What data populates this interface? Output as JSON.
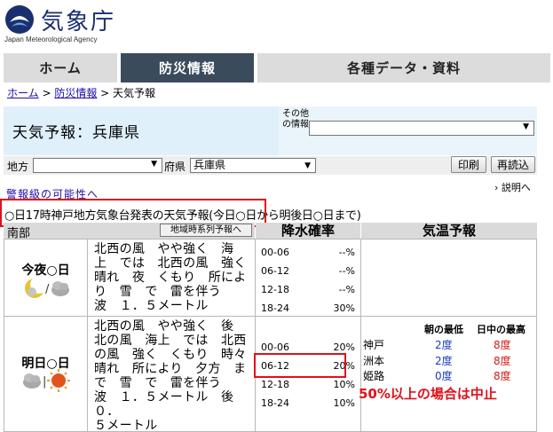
{
  "logo": {
    "text": "気象庁",
    "subtitle": "Japan Meteorological Agency",
    "icon": "jma-logo-icon"
  },
  "nav": {
    "home": "ホーム",
    "bosai": "防災情報",
    "data": "各種データ・資料"
  },
  "breadcrumb": {
    "home": "ホーム",
    "sep1": " > ",
    "bosai": "防災情報",
    "sep2": " > ",
    "current": "天気予報"
  },
  "title": "天気予報：兵庫県",
  "other_info": {
    "label": "その他の情報",
    "selected": ""
  },
  "region": {
    "label": "地方",
    "selected": "",
    "pref_label": "府県",
    "pref_selected": "兵庫県"
  },
  "buttons": {
    "print": "印刷",
    "reload": "再読込"
  },
  "warning_link": "警報級の可能性へ",
  "help_link": "説明へ",
  "announcement": "○日17時神戸地方気象台発表の天気予報(今日○日から明後日○日まで)",
  "table": {
    "col_area": "南部",
    "col_area_button": "地域時系列予報へ",
    "col_rain": "降水確率",
    "col_temp": "気温予報"
  },
  "days": [
    {
      "label": "今夜○日",
      "icons": [
        "moon-icon",
        "cloud-icon"
      ],
      "text": [
        "北西の風　やや強く　海",
        "上　では　北西の風　強く",
        "晴れ　夜　くもり　所によ",
        "り　雪　で　雷を伴う",
        "波　１．５メートル"
      ],
      "rain": [
        {
          "time": "00-06",
          "value": "--%"
        },
        {
          "time": "06-12",
          "value": "--%"
        },
        {
          "time": "12-18",
          "value": "--%"
        },
        {
          "time": "18-24",
          "value": "30%"
        }
      ]
    },
    {
      "label": "明日○日",
      "icons": [
        "cloud-icon",
        "sun-icon"
      ],
      "text": [
        "北西の風　やや強く　後",
        "北の風　海上　では　北西",
        "の風　強く　くもり　時々",
        "晴れ　所により　夕方　ま",
        "で　雪　で　雷を伴う",
        "波　１．５メートル　後　０．",
        "５メートル"
      ],
      "rain": [
        {
          "time": "00-06",
          "value": "20%"
        },
        {
          "time": "06-12",
          "value": "20%"
        },
        {
          "time": "12-18",
          "value": "10%"
        },
        {
          "time": "18-24",
          "value": "10%"
        }
      ],
      "temp": {
        "header_min": "朝の最低",
        "header_max": "日中の最高",
        "rows": [
          {
            "city": "神戸",
            "min": "2度",
            "max": "8度"
          },
          {
            "city": "洲本",
            "min": "2度",
            "max": "8度"
          },
          {
            "city": "姫路",
            "min": "0度",
            "max": "8度"
          }
        ]
      }
    }
  ],
  "note": "50%以上の場合は中止",
  "colors": {
    "accent_red": "#e0101b",
    "nav_active": "#3a4b5c",
    "title_bg": "#dff0fb",
    "min_temp": "#1a3fc0",
    "max_temp": "#d01a1a"
  }
}
